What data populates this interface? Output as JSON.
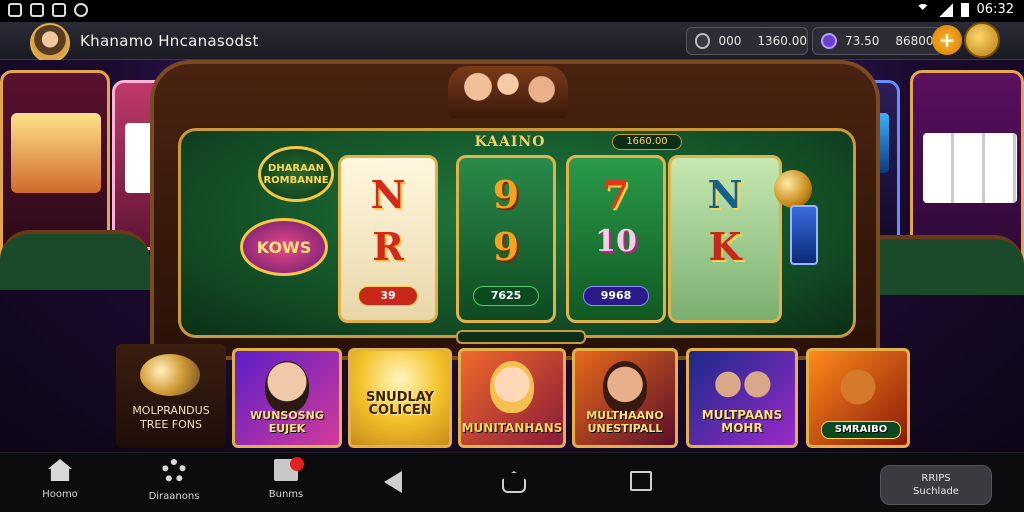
{
  "status_bar": {
    "time": "06:32",
    "icons": [
      "notification-icon",
      "screenshot-icon",
      "gallery-icon",
      "globe-icon"
    ],
    "right_icons": [
      "wifi-icon",
      "signal-icon",
      "battery-icon"
    ]
  },
  "header": {
    "player_name": "Khanamo Hncanasodst",
    "balance_primary": {
      "icon": "coin-icon",
      "value_a": "000",
      "value_b": "1360.00"
    },
    "balance_secondary": {
      "icon": "gem-icon",
      "value_a": "73.50",
      "value_b": "86800"
    },
    "add_label": "+"
  },
  "machine": {
    "title": "KAAINO",
    "badge": "1660.00",
    "logo_top": "DHARAAN ROMBANNE",
    "logo_bottom": "KOWS",
    "reels": [
      {
        "top": "N",
        "bottom": "R",
        "label": "39"
      },
      {
        "top": "9",
        "bottom": "9",
        "label": "7625"
      },
      {
        "top": "7",
        "bottom": "10",
        "label": "9968"
      },
      {
        "top": "N",
        "bottom": "K",
        "label": ""
      }
    ]
  },
  "games": {
    "promo_text_1": "MOLPRANDUS",
    "promo_text_2": "TREE FONS",
    "cards": [
      {
        "title": "WUNSOSNG\nEUJEK"
      },
      {
        "title": "SNUDLAY\nCOLICEN"
      },
      {
        "title": "MUNITANHANS"
      },
      {
        "title": "MULTHAANO\nUNESTIPALL"
      },
      {
        "title": "MULTPAANS\nMOHR"
      },
      {
        "title": "SMRAIBO"
      }
    ]
  },
  "nav": {
    "home": "Hoomo",
    "settings": "Diraanons",
    "bonus": "Bunms",
    "side_button_line1": "RRIPS",
    "side_button_line2": "Suchlade"
  },
  "colors": {
    "felt": "#1f7a3c",
    "gold_trim": "#e3b14a",
    "background_purple": "#3a1770",
    "notification_red": "#e52020"
  }
}
